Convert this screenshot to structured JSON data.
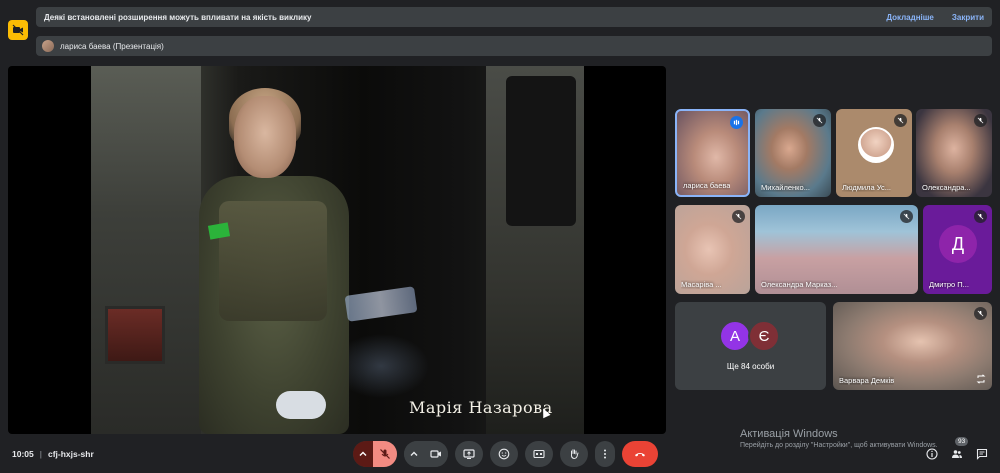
{
  "banner": {
    "message": "Деякі встановлені розширення можуть впливати на якість виклику",
    "details_link": "Докладніше",
    "close_link": "Закрити"
  },
  "presenter": {
    "label": "лариса баева (Презентація)"
  },
  "slide": {
    "caption": "Марія Назарова"
  },
  "tiles": [
    {
      "name": "лариса баева"
    },
    {
      "name": "Михайленко..."
    },
    {
      "name": "Людмила Ус..."
    },
    {
      "name": "Олександра..."
    },
    {
      "name": "Масаріва ..."
    },
    {
      "name": "Олександра Марказ..."
    },
    {
      "name": "Дмитро П...",
      "initial": "Д"
    },
    {
      "name": "Ще 84 особи",
      "initials": [
        "А",
        "Є"
      ]
    },
    {
      "name": "Варвара Демків"
    }
  ],
  "meeting": {
    "time": "10:05",
    "separator": "|",
    "code": "cfj-hxjs-shr"
  },
  "watermark": {
    "title": "Активація Windows",
    "subtitle": "Перейдіть до розділу \"Настройки\", щоб активувати Windows."
  },
  "participants_badge": "93",
  "colors": {
    "accent": "#8ab4f8",
    "end_call": "#ea4335",
    "mic_off": "#f28b82",
    "ext_warning": "#fbbc04"
  }
}
